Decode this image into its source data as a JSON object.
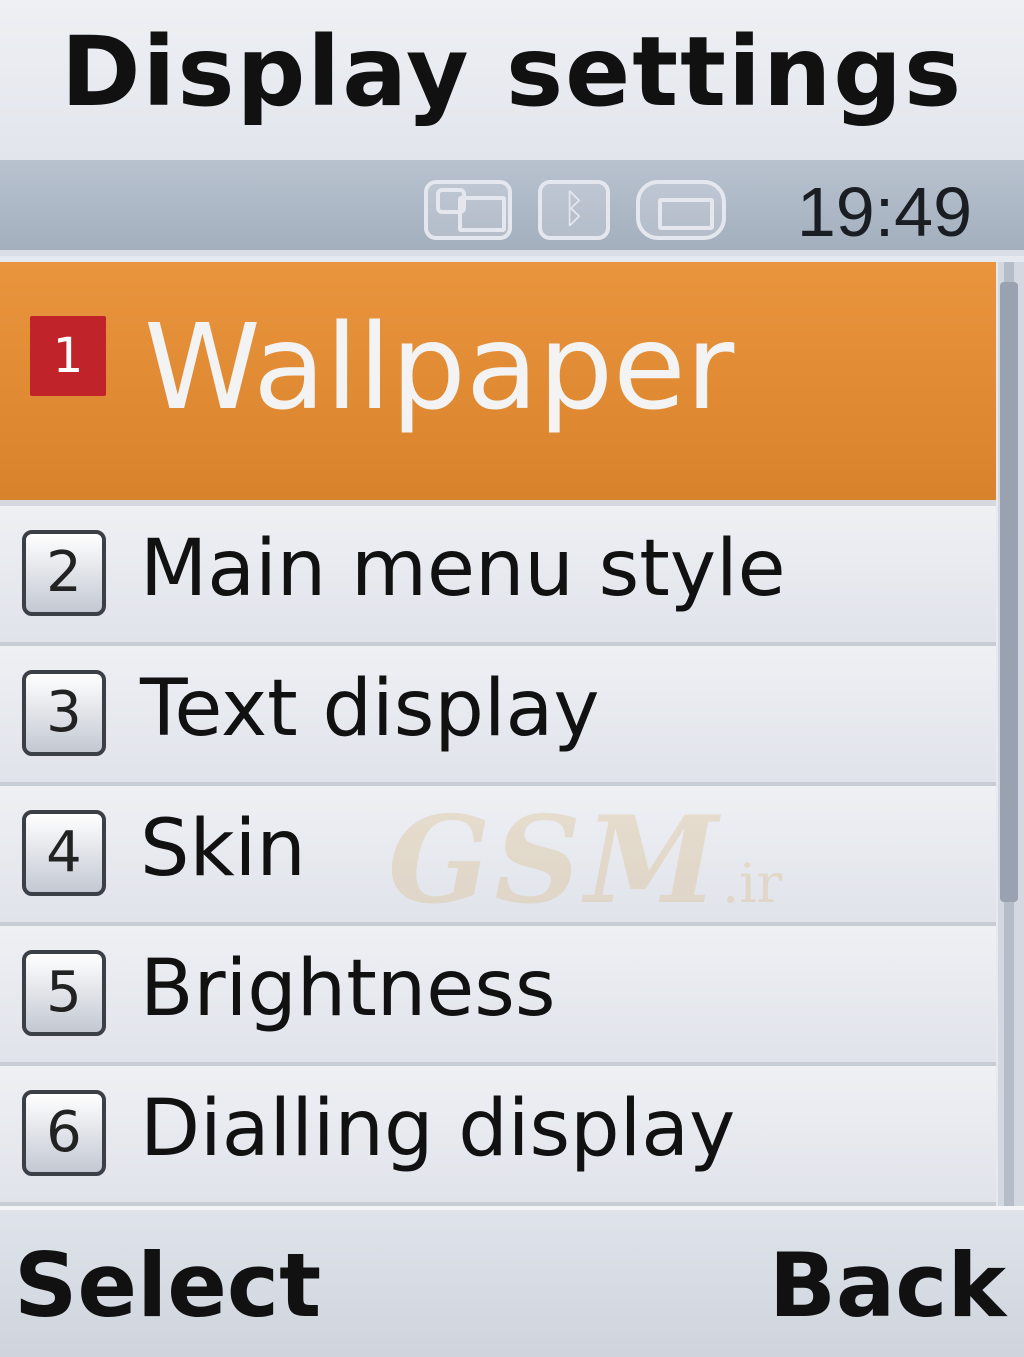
{
  "header": {
    "title": "Display settings"
  },
  "status_bar": {
    "time": "19:49",
    "icons": [
      "message-icon",
      "bluetooth-icon",
      "battery-icon"
    ]
  },
  "menu": {
    "items": [
      {
        "number": "1",
        "label": "Wallpaper",
        "selected": true
      },
      {
        "number": "2",
        "label": "Main menu style",
        "selected": false
      },
      {
        "number": "3",
        "label": "Text display",
        "selected": false
      },
      {
        "number": "4",
        "label": "Skin",
        "selected": false
      },
      {
        "number": "5",
        "label": "Brightness",
        "selected": false
      },
      {
        "number": "6",
        "label": "Dialling display",
        "selected": false
      }
    ]
  },
  "watermark": {
    "text": "GSM",
    "suffix": ".ir"
  },
  "softkeys": {
    "left_label": "Select",
    "right_label": "Back"
  },
  "colors": {
    "selected_background": "#de8a32",
    "selected_badge": "#c1232a",
    "status_bar": "#aab4c2"
  }
}
